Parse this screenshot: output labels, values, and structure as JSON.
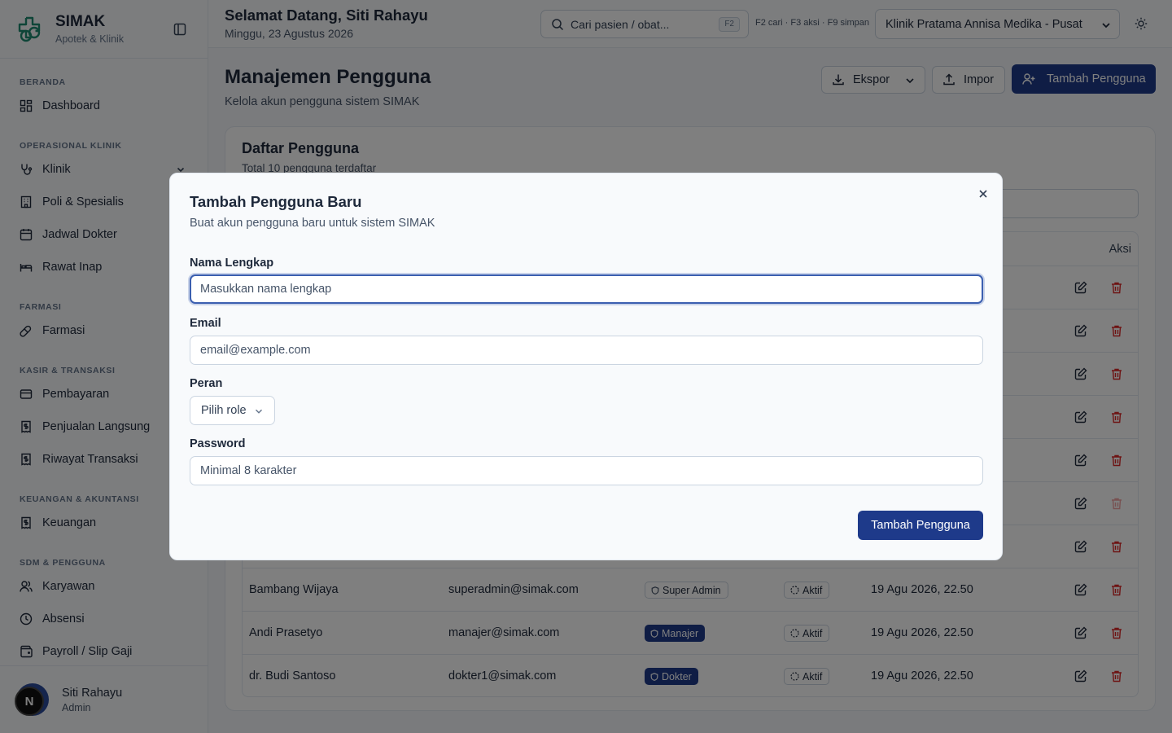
{
  "brand": {
    "title": "SIMAK",
    "subtitle": "Apotek & Klinik"
  },
  "sidebar": {
    "sections": [
      {
        "label": "BERANDA",
        "items": [
          {
            "label": "Dashboard",
            "icon": "dashboard-icon"
          }
        ]
      },
      {
        "label": "OPERASIONAL KLINIK",
        "items": [
          {
            "label": "Klinik",
            "icon": "stethoscope-icon",
            "expandable": true
          },
          {
            "label": "Poli & Spesialis",
            "icon": "building-icon"
          },
          {
            "label": "Jadwal Dokter",
            "icon": "calendar-icon"
          },
          {
            "label": "Rawat Inap",
            "icon": "bed-icon"
          }
        ]
      },
      {
        "label": "FARMASI",
        "items": [
          {
            "label": "Farmasi",
            "icon": "pill-icon"
          }
        ]
      },
      {
        "label": "KASIR & TRANSAKSI",
        "items": [
          {
            "label": "Pembayaran",
            "icon": "credit-card-icon"
          },
          {
            "label": "Penjualan Langsung",
            "icon": "receipt-icon"
          },
          {
            "label": "Riwayat Transaksi",
            "icon": "receipt-icon"
          }
        ]
      },
      {
        "label": "KEUANGAN & AKUNTANSI",
        "items": [
          {
            "label": "Keuangan",
            "icon": "receipt-icon"
          }
        ]
      },
      {
        "label": "SDM & PENGGUNA",
        "items": [
          {
            "label": "Karyawan",
            "icon": "users-icon"
          },
          {
            "label": "Absensi",
            "icon": "clock-icon"
          },
          {
            "label": "Payroll / Slip Gaji",
            "icon": "wallet-icon"
          }
        ]
      }
    ],
    "user": {
      "initial": "N",
      "name": "Siti Rahayu",
      "role": "Admin"
    }
  },
  "header": {
    "greeting": "Selamat Datang, Siti Rahayu",
    "date": "Minggu, 23 Agustus 2026",
    "search_placeholder": "Cari pasien / obat...",
    "search_kbd": "F2",
    "shortcuts": "F2 cari · F3 aksi · F9 simpan",
    "clinic": "Klinik Pratama Annisa Medika - Pusat"
  },
  "page": {
    "title": "Manajemen Pengguna",
    "subtitle": "Kelola akun pengguna sistem SIMAK",
    "export_label": "Ekspor",
    "import_label": "Impor",
    "add_label": "Tambah Pengguna"
  },
  "card": {
    "title": "Daftar Pengguna",
    "subtitle": "Total 10 pengguna terdaftar",
    "action_header": "Aksi",
    "rows": [
      {
        "name": "",
        "email": "",
        "role": "",
        "status": "",
        "date": ""
      },
      {
        "name": "",
        "email": "",
        "role": "",
        "status": "",
        "date": ""
      },
      {
        "name": "",
        "email": "",
        "role": "",
        "status": "",
        "date": ""
      },
      {
        "name": "",
        "email": "",
        "role": "",
        "status": "",
        "date": ""
      },
      {
        "name": "",
        "email": "",
        "role": "",
        "status": "",
        "date": ""
      },
      {
        "name": "",
        "email": "",
        "role": "",
        "status": "",
        "date": "",
        "delete_disabled": true
      },
      {
        "name": "",
        "email": "",
        "role": "",
        "status": "",
        "date": ""
      },
      {
        "name": "Bambang Wijaya",
        "email": "superadmin@simak.com",
        "role": "Super Admin",
        "role_style": "outline",
        "status": "Aktif",
        "date": "19 Agu 2026, 22.50"
      },
      {
        "name": "Andi Prasetyo",
        "email": "manajer@simak.com",
        "role": "Manajer",
        "role_style": "filled",
        "status": "Aktif",
        "date": "19 Agu 2026, 22.50"
      },
      {
        "name": "dr. Budi Santoso",
        "email": "dokter1@simak.com",
        "role": "Dokter",
        "role_style": "filled",
        "status": "Aktif",
        "date": "19 Agu 2026, 22.50"
      }
    ]
  },
  "modal": {
    "title": "Tambah Pengguna Baru",
    "description": "Buat akun pengguna baru untuk sistem SIMAK",
    "name_label": "Nama Lengkap",
    "name_placeholder": "Masukkan nama lengkap",
    "email_label": "Email",
    "email_placeholder": "email@example.com",
    "role_label": "Peran",
    "role_placeholder": "Pilih role",
    "password_label": "Password",
    "password_placeholder": "Minimal 8 karakter",
    "submit_label": "Tambah Pengguna"
  },
  "colors": {
    "primary": "#1e3a8a",
    "danger": "#dc2626",
    "brand_green": "#1f8a70"
  }
}
